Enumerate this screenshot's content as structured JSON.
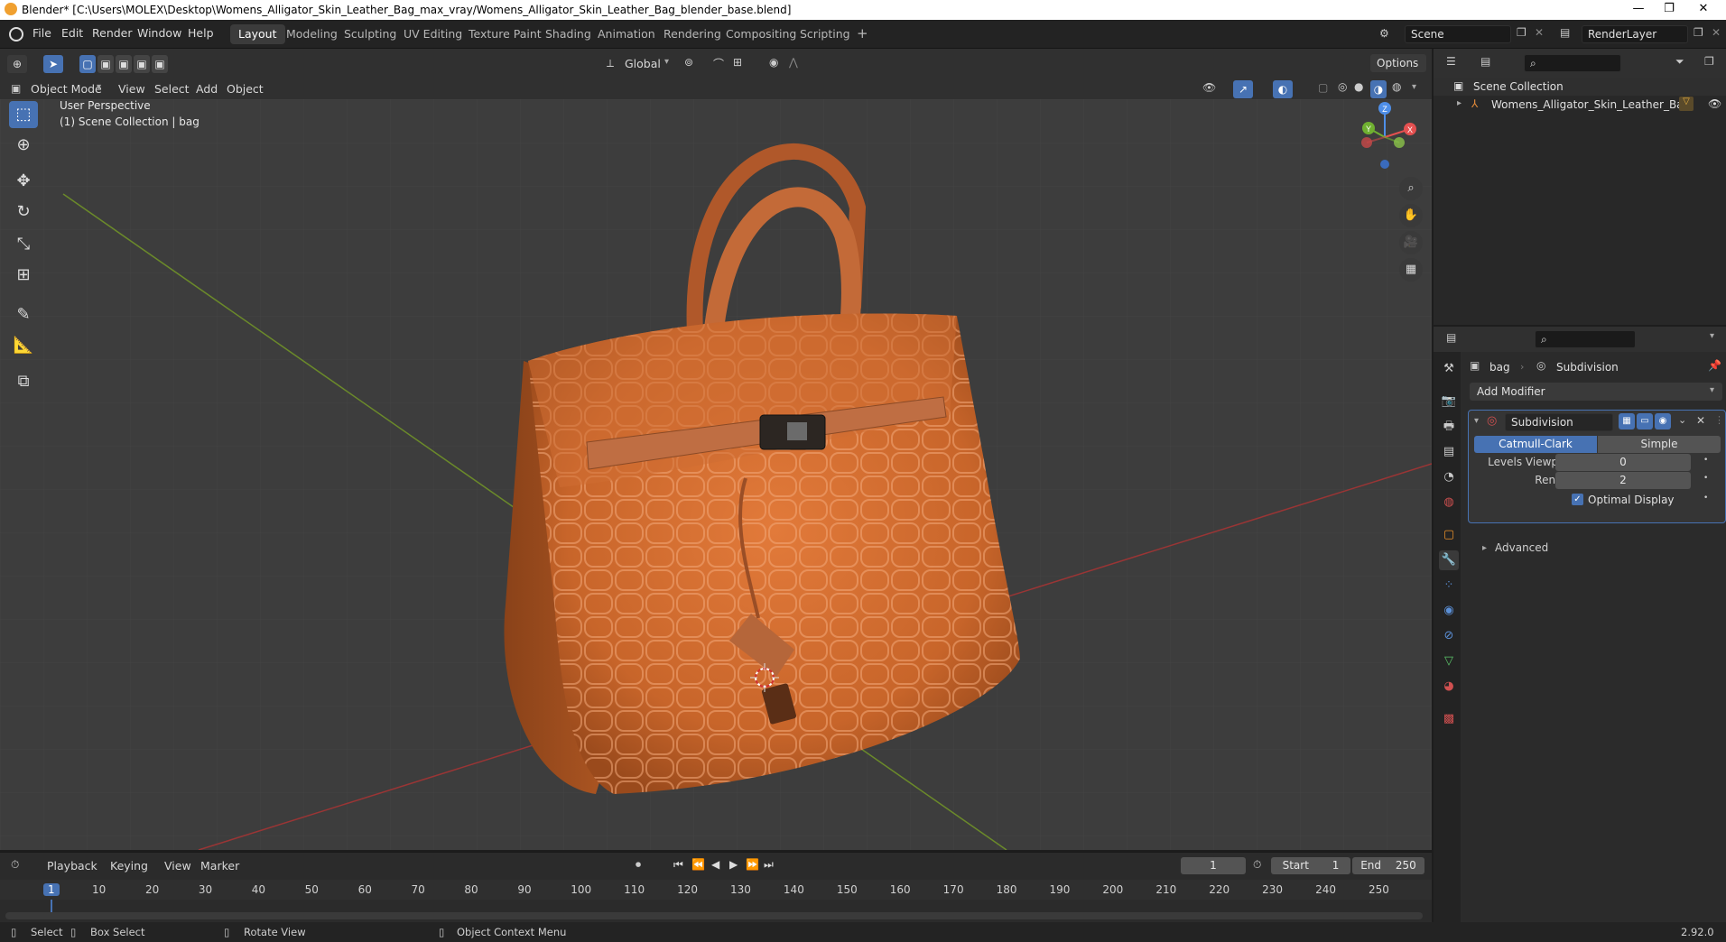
{
  "window": {
    "title": "Blender* [C:\\Users\\MOLEX\\Desktop\\Womens_Alligator_Skin_Leather_Bag_max_vray/Womens_Alligator_Skin_Leather_Bag_blender_base.blend]"
  },
  "menu": {
    "file": "File",
    "edit": "Edit",
    "render": "Render",
    "window": "Window",
    "help": "Help"
  },
  "workspaces": [
    "Layout",
    "Modeling",
    "Sculpting",
    "UV Editing",
    "Texture Paint",
    "Shading",
    "Animation",
    "Rendering",
    "Compositing",
    "Scripting"
  ],
  "scene": {
    "name": "Scene",
    "render_layer": "RenderLayer"
  },
  "viewport_header": {
    "transform_orientation": "Global",
    "options_label": "Options",
    "mode": "Object Mode",
    "view": "View",
    "select": "Select",
    "add": "Add",
    "object": "Object"
  },
  "viewport": {
    "perspective": "User Perspective",
    "collection_info": "(1) Scene Collection | bag",
    "gizmo": {
      "z": "Z",
      "y": "Y",
      "x": "X"
    }
  },
  "outliner": {
    "root": "Scene Collection",
    "items": [
      "Womens_Alligator_Skin_Leather_Bag"
    ]
  },
  "properties": {
    "breadcrumb_object": "bag",
    "breadcrumb_modifier": "Subdivision",
    "add_modifier": "Add Modifier",
    "modifier_name": "Subdivision",
    "type_catmull": "Catmull-Clark",
    "type_simple": "Simple",
    "levels_viewport_label": "Levels Viewport",
    "levels_viewport_value": "0",
    "render_label": "Render",
    "render_value": "2",
    "optimal_display": "Optimal Display",
    "advanced": "Advanced"
  },
  "timeline": {
    "playback": "Playback",
    "keying": "Keying",
    "view": "View",
    "marker": "Marker",
    "current_frame": "1",
    "start_label": "Start",
    "start": "1",
    "end_label": "End",
    "end": "250",
    "ruler": [
      "1",
      "10",
      "20",
      "30",
      "40",
      "50",
      "60",
      "70",
      "80",
      "90",
      "100",
      "110",
      "120",
      "130",
      "140",
      "150",
      "160",
      "170",
      "180",
      "190",
      "200",
      "210",
      "220",
      "230",
      "240",
      "250"
    ]
  },
  "statusbar": {
    "select": "Select",
    "box_select": "Box Select",
    "rotate_view": "Rotate View",
    "context_menu": "Object Context Menu",
    "version": "2.92.0"
  },
  "colors": {
    "accent": "#4772b3",
    "bag": "#c8652a",
    "viewport_bg": "#3d3d3d"
  }
}
